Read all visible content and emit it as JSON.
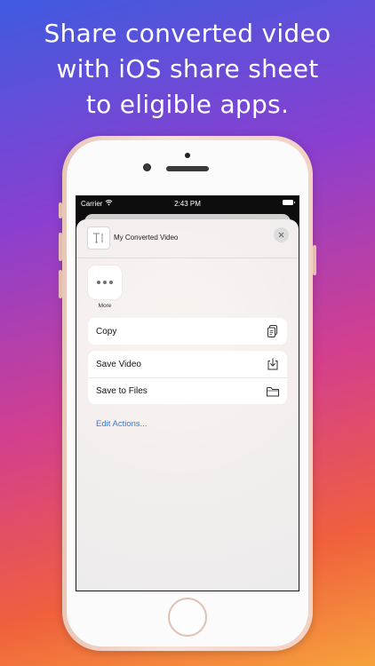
{
  "headline": {
    "line1": "Share converted video",
    "line2": "with iOS share sheet",
    "line3": "to eligible apps."
  },
  "status_bar": {
    "carrier": "Carrier",
    "time": "2:43 PM",
    "icons": [
      "wifi-icon",
      "battery-icon"
    ]
  },
  "share_sheet": {
    "file_title": "My Converted Video",
    "file_icon": "text-document-icon",
    "close_icon": "close-icon",
    "apps": [
      {
        "label": "More",
        "icon": "more-dots-icon"
      }
    ],
    "actions": [
      {
        "label": "Copy",
        "icon": "copy-icon"
      },
      {
        "label": "Save Video",
        "icon": "save-download-icon"
      },
      {
        "label": "Save to Files",
        "icon": "folder-icon"
      }
    ],
    "edit_actions_label": "Edit Actions...",
    "link_color": "#2f7ad9"
  },
  "colors": {
    "background_gradient": [
      "#3f5be0",
      "#8a3fd0",
      "#d43f8d",
      "#f0603c",
      "#f6a13c"
    ],
    "phone_frame": "#f2d2c4"
  }
}
